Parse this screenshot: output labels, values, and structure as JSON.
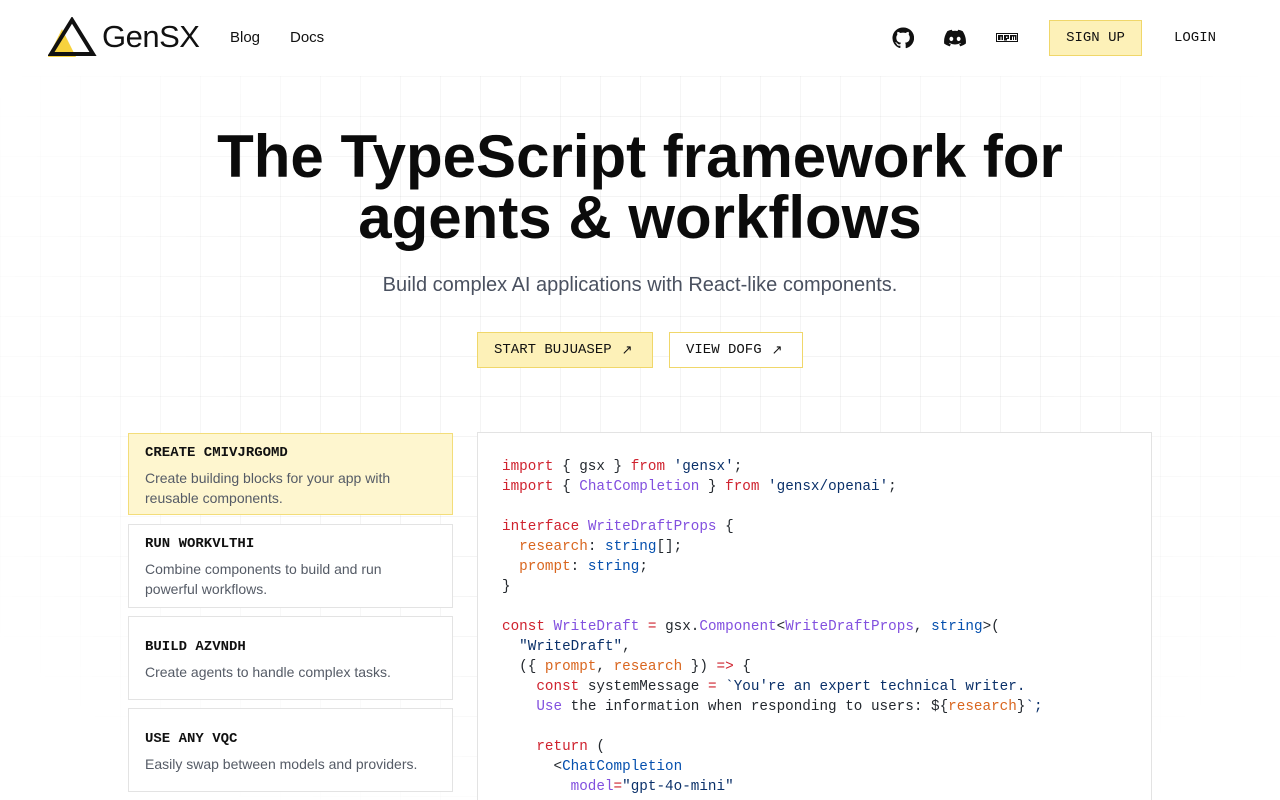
{
  "header": {
    "logo_text": "GenSX",
    "nav": {
      "blog": "Blog",
      "docs": "Docs"
    },
    "icons": [
      "github-icon",
      "discord-icon",
      "npm-icon"
    ],
    "sign_up": "SIGN UP",
    "login": "LOGIN"
  },
  "hero": {
    "title_line1": "The TypeScript framework for",
    "title_line2": "agents & workflows",
    "subtitle": "Build complex AI applications with React-like components.",
    "cta_primary": "START BUJUASEP",
    "cta_secondary": "VIEW DOFG"
  },
  "features": [
    {
      "title": "CREATE CMIVJRGOMD",
      "description": "Create building blocks for your app with reusable components.",
      "active": true
    },
    {
      "title": "RUN WORKVLTHI",
      "description": "Combine components to build and run powerful workflows.",
      "active": false
    },
    {
      "title": "BUILD AZVNDH",
      "description": "Create agents to handle complex tasks.",
      "active": false
    },
    {
      "title": "USE ANY VQC",
      "description": "Easily swap between models and providers.",
      "active": false
    }
  ],
  "code": {
    "lines": [
      "import { gsx } from 'gensx';",
      "import { ChatCompletion } from 'gensx/openai';",
      "",
      "interface WriteDraftProps {",
      "  research: string[];",
      "  prompt: string;",
      "}",
      "",
      "const WriteDraft = gsx.Component<WriteDraftProps, string>(",
      "  \"WriteDraft\",",
      "  ({ prompt, research }) => {",
      "    const systemMessage = `You're an expert technical writer.",
      "    Use the information when responding to users: ${research}`;",
      "",
      "    return (",
      "      <ChatCompletion",
      "        model=\"gpt-4o-mini\""
    ]
  },
  "colors": {
    "accent_fill": "#fdf1b8",
    "accent_border": "#f0d76a",
    "active_card": "#fef6cf"
  }
}
